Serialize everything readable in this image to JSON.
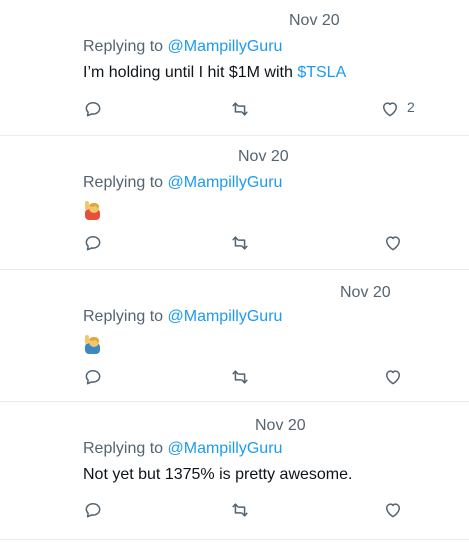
{
  "tweets": [
    {
      "date": "Nov 20",
      "replying_prefix": "Replying to ",
      "replying_handle": "@MampillyGuru",
      "text_main": "I’m holding until I hit $1M with ",
      "cashtag": "$TSLA",
      "like_count": "2"
    },
    {
      "date": "Nov 20",
      "replying_prefix": "Replying to ",
      "replying_handle": "@MampillyGuru",
      "emoji": "person-raising-hand-emoji"
    },
    {
      "date": "Nov 20",
      "replying_prefix": "Replying to ",
      "replying_handle": "@MampillyGuru",
      "emoji": "person-raising-hand-emoji"
    },
    {
      "date": "Nov 20",
      "replying_prefix": "Replying to ",
      "replying_handle": "@MampillyGuru",
      "text_main": "Not yet but 1375% is pretty awesome."
    }
  ],
  "colors": {
    "accent": "#1d9bf0",
    "secondary_text": "#536471",
    "icon": "#536471",
    "divider": "#e6ecf0"
  }
}
